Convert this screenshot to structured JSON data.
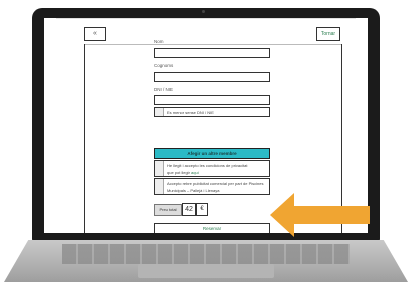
{
  "topbar": {
    "back_label": "«",
    "tornar_label": "Tornar"
  },
  "form": {
    "nom_label": "Nom",
    "cognoms_label": "Cognoms",
    "dni_label": "DNI / NIE",
    "menor_label": "Es menor sense DNI / NIE",
    "add_member_label": "Afegir un altre membre",
    "legal_text": "He llegit i accepto les condicions de privacitat",
    "legal_link_prefix": "que pot llegir ",
    "legal_link": "aquí",
    "publicity_text": "Accepto rebre publicitat comercial per part de Piscines Municipals – Pallejà i Llenaya",
    "preu_label": "Preu total",
    "preu_value": "42",
    "currency": "€",
    "reserva_label": "Reservar"
  },
  "colors": {
    "accent": "#2bbac6",
    "arrow": "#f0a532",
    "link": "#2a7d4f"
  },
  "icons": {
    "arrow": "orange-pointer-arrow-icon"
  }
}
